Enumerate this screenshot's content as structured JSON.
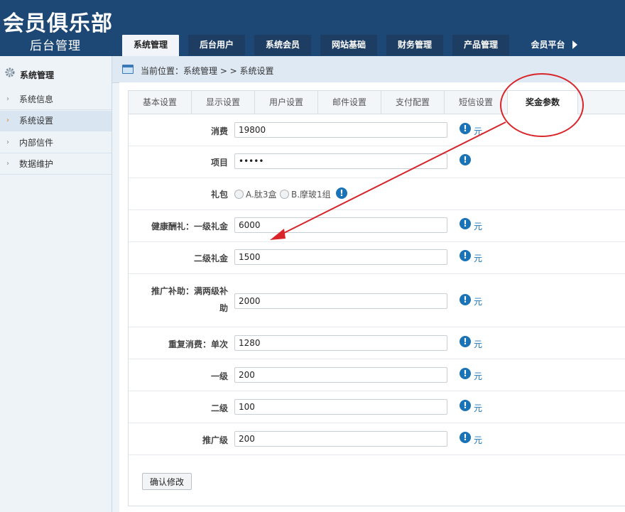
{
  "header": {
    "title": "会员俱乐部",
    "subtitle": "后台管理",
    "nav": [
      {
        "label": "系统管理",
        "active": true
      },
      {
        "label": "后台用户"
      },
      {
        "label": "系统会员"
      },
      {
        "label": "网站基础"
      },
      {
        "label": "财务管理"
      },
      {
        "label": "产品管理"
      },
      {
        "label": "会员平台"
      }
    ]
  },
  "sidebar": {
    "heading": "系统管理",
    "items": [
      {
        "label": "系统信息"
      },
      {
        "label": "系统设置",
        "active": true
      },
      {
        "label": "内部信件"
      },
      {
        "label": "数据维护"
      }
    ]
  },
  "breadcrumb": "当前位置：系统管理 > > 系统设置",
  "tabs": [
    {
      "label": "基本设置"
    },
    {
      "label": "显示设置"
    },
    {
      "label": "用户设置"
    },
    {
      "label": "邮件设置"
    },
    {
      "label": "支付配置"
    },
    {
      "label": "短信设置"
    },
    {
      "label": "奖金参数",
      "active": true
    }
  ],
  "form": {
    "consumption": {
      "label": "消费",
      "value": "19800",
      "unit": "元"
    },
    "project": {
      "label": "项目",
      "value": "•••••"
    },
    "gift": {
      "label": "礼包",
      "option_a": "A.肽3盒",
      "option_b": "B.摩玻1组"
    },
    "health_level1": {
      "label": "健康酬礼：一级礼金",
      "value": "6000",
      "unit": "元"
    },
    "level2_gift": {
      "label": "二级礼金",
      "value": "1500",
      "unit": "元"
    },
    "promo_subsidy": {
      "label": "推广补助：满两级补助",
      "value": "2000",
      "unit": "元"
    },
    "repeat_single": {
      "label": "重复消费：单次",
      "value": "1280",
      "unit": "元"
    },
    "level1": {
      "label": "一级",
      "value": "200",
      "unit": "元"
    },
    "level2": {
      "label": "二级",
      "value": "100",
      "unit": "元"
    },
    "promo_level": {
      "label": "推广级",
      "value": "200",
      "unit": "元"
    },
    "submit": "确认修改"
  },
  "info_glyph": "!",
  "annotation_color": "#d9252a"
}
